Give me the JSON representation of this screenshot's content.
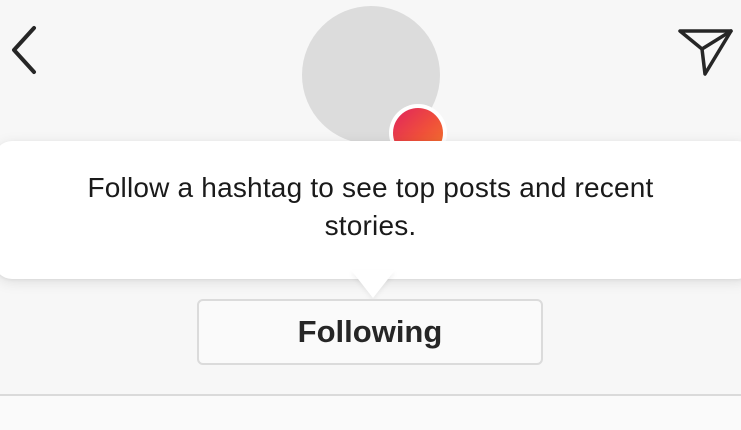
{
  "header": {
    "back_icon": "chevron-left-icon",
    "direct_icon": "paper-plane-icon"
  },
  "profile": {
    "avatar_color": "#dcdcdc",
    "story_badge_colors": [
      "#e0245e",
      "#f27a2a"
    ]
  },
  "tooltip": {
    "line1": "Follow a hashtag to see top posts and recent",
    "line2": "stories."
  },
  "actions": {
    "following_label": "Following"
  }
}
